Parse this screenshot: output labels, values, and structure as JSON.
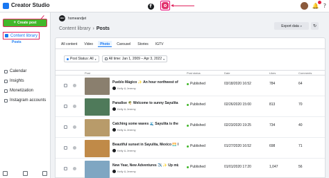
{
  "app": {
    "title": "Creator Studio"
  },
  "topbar": {
    "platform_tabs": [
      {
        "name": "Facebook",
        "glyph": "f"
      },
      {
        "name": "Instagram",
        "active": true
      }
    ],
    "icons": [
      "avatar",
      "bell-icon",
      "help-icon"
    ]
  },
  "sidebar": {
    "create_label": "Create post",
    "create_glyph": "+",
    "content_library": "Content library",
    "posts": "Posts",
    "items": [
      "Calendar",
      "Insights",
      "Monetization",
      "Instagram accounts"
    ]
  },
  "header": {
    "account_name": "homeandjet",
    "account_initials": "H&J",
    "breadcrumb_root": "Content library",
    "breadcrumb_sep": "›",
    "breadcrumb_current": "Posts",
    "export_label": "Export data",
    "export_chevron": "▾",
    "refresh_glyph": "↻"
  },
  "tabs": [
    "All content",
    "Video",
    "Photo",
    "Carousel",
    "Stories",
    "IGTV"
  ],
  "active_tab": "Photo",
  "filters": {
    "status": "Post Status: All",
    "time": "All time: Jan 1, 2009 – Apr 3, 2022",
    "chevron": "▾"
  },
  "table": {
    "headers": [
      "Post",
      "Post status",
      "Date",
      "Likes",
      "Comments"
    ],
    "rows": [
      {
        "caption": "Pueblo Mágico ✨ An hour northwest of P",
        "author": "Kelly & Jeremy",
        "status": "Published",
        "date": "03/18/2020 16:52",
        "likes": "784",
        "comments": "64",
        "thumb_color": "#8a7f6e"
      },
      {
        "caption": "Paradise 🌴 Welcome to sunny Sayulita!",
        "author": "Kelly & Jeremy",
        "status": "Published",
        "date": "02/26/2020 15:00",
        "likes": "813",
        "comments": "70",
        "thumb_color": "#4f7a5a"
      },
      {
        "caption": "Catching some waves 🌊 Sayulita is the p",
        "author": "Kelly & Jeremy",
        "status": "Published",
        "date": "02/23/2020 19:25",
        "likes": "734",
        "comments": "40",
        "thumb_color": "#b89b6a"
      },
      {
        "caption": "Beautiful sunset in Sayulita, Mexico 🌅 Fe",
        "author": "Kelly & Jeremy",
        "status": "Published",
        "date": "01/27/2020 16:52",
        "likes": "698",
        "comments": "71",
        "thumb_color": "#c08a48"
      },
      {
        "caption": "New Year, New Adventures ✈️ ✨ Up mighty",
        "author": "Kelly & Jeremy",
        "status": "Published",
        "date": "01/01/2020 17:20",
        "likes": "1,047",
        "comments": "56",
        "thumb_color": "#7fa6c2"
      }
    ]
  }
}
